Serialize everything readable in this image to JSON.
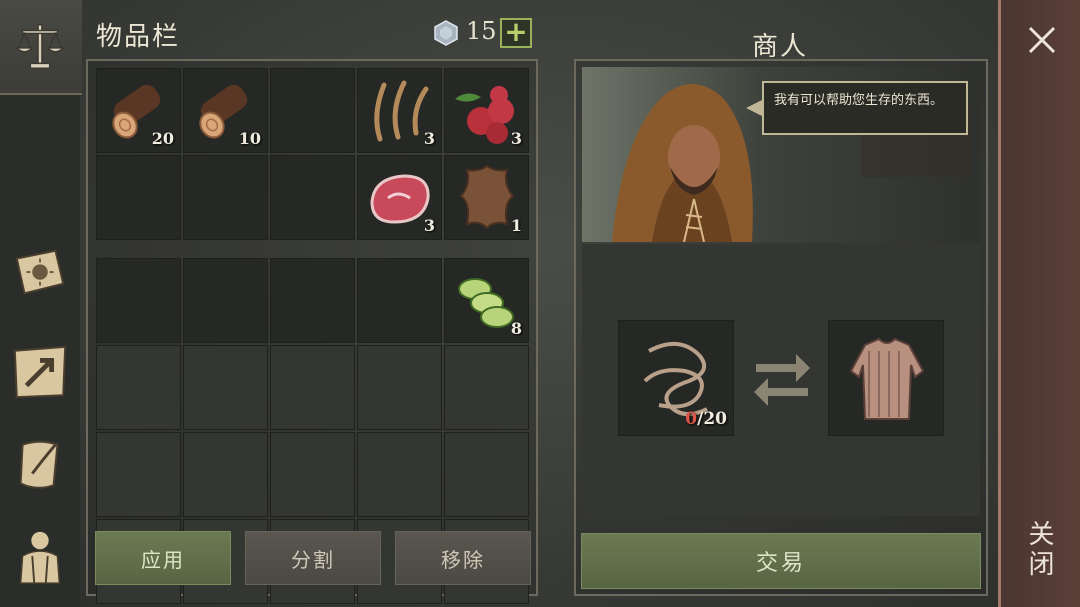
{
  "inventory": {
    "title": "物品栏",
    "currency": {
      "icon": "gem-icon",
      "count": "15",
      "add_label": "+"
    },
    "top_slots": [
      {
        "item": "wood-log-icon",
        "qty": "20"
      },
      {
        "item": "wood-log-icon",
        "qty": "10"
      },
      {
        "item": "",
        "qty": ""
      },
      {
        "item": "dry-grass-icon",
        "qty": "3"
      },
      {
        "item": "berries-icon",
        "qty": "3"
      },
      {
        "item": "",
        "qty": ""
      },
      {
        "item": "",
        "qty": ""
      },
      {
        "item": "",
        "qty": ""
      },
      {
        "item": "raw-meat-icon",
        "qty": "3"
      },
      {
        "item": "animal-hide-icon",
        "qty": "1"
      }
    ],
    "bottom_slots": [
      {
        "item": "",
        "qty": ""
      },
      {
        "item": "",
        "qty": ""
      },
      {
        "item": "",
        "qty": ""
      },
      {
        "item": "",
        "qty": ""
      },
      {
        "item": "cucumber-slices-icon",
        "qty": "8"
      }
    ],
    "buttons": {
      "apply": "应用",
      "split": "分割",
      "remove": "移除"
    }
  },
  "trader": {
    "title": "商人",
    "speech": "我有可以帮助您生存的东西。",
    "give_item": {
      "icon": "rope-icon",
      "have": "0",
      "need": "/20"
    },
    "get_item": {
      "icon": "chainmail-shirt-icon"
    },
    "trade_label": "交易"
  },
  "close": {
    "label": "关闭"
  },
  "colors": {
    "accent_green": "#6b7a52",
    "close_strip": "#5a3f38",
    "qty_red": "#e0544a"
  }
}
